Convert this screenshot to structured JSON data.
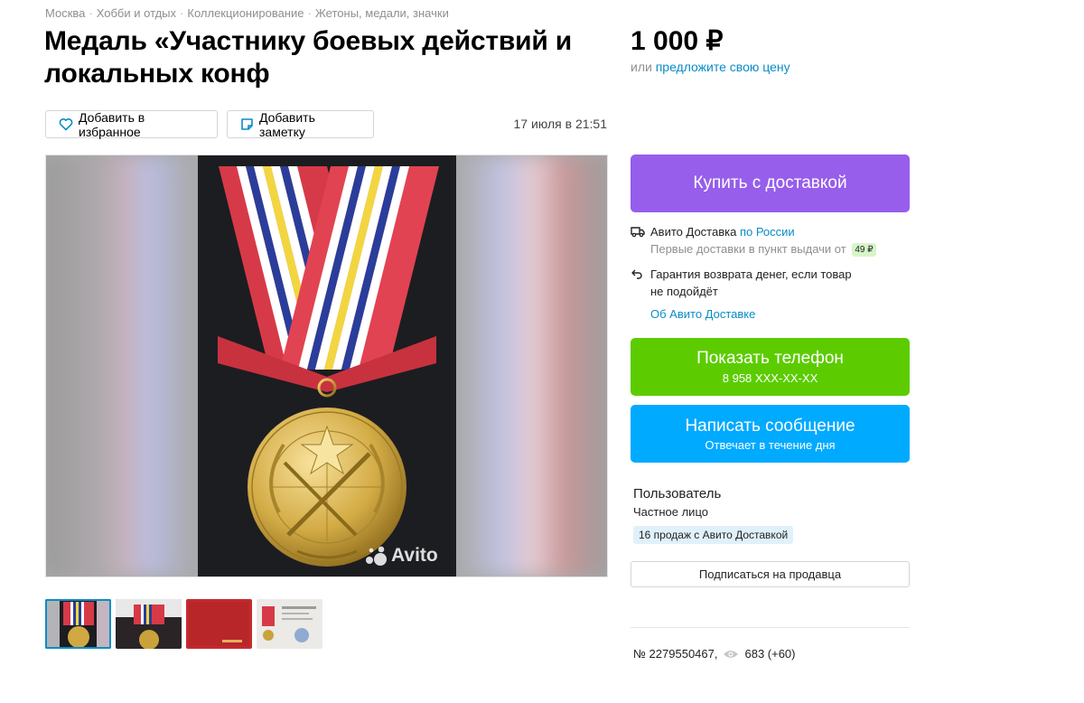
{
  "breadcrumbs": [
    "Москва",
    "Хобби и отдых",
    "Коллекционирование",
    "Жетоны, медали, значки"
  ],
  "title": "Медаль «Участнику боевых действий и локальных конф",
  "price": "1 000 ₽",
  "price_offer": {
    "prefix": "или",
    "link": "предложите свою цену"
  },
  "actions": {
    "favorite": "Добавить в избранное",
    "note": "Добавить заметку"
  },
  "date": "17 июля в 21:51",
  "gallery": {
    "watermark": "Avito",
    "thumb_count": 4,
    "active_thumb": 0
  },
  "buy_button": "Купить с доставкой",
  "delivery": {
    "label": "Авито Доставка",
    "region_link": "по России",
    "first_text": "Первые доставки в пункт выдачи от",
    "first_price": "49 ₽"
  },
  "guarantee": {
    "line1": "Гарантия возврата денег, если товар",
    "line2": "не подойдёт"
  },
  "about_delivery_link": "Об Авито Доставке",
  "phone_button": {
    "label": "Показать телефон",
    "number": "8 958 XXX-XX-XX"
  },
  "message_button": {
    "label": "Написать сообщение",
    "sub": "Отвечает в течение дня"
  },
  "seller": {
    "name": "Пользователь",
    "type": "Частное лицо",
    "badge": "16 продаж с Авито Доставкой"
  },
  "subscribe_button": "Подписаться на продавца",
  "meta": {
    "id": "№ 2279550467,",
    "views": "683 (+60)"
  },
  "colors": {
    "buy": "#965eeb",
    "phone": "#5ccc00",
    "message": "#00aaff",
    "link": "#0a8cc7"
  }
}
